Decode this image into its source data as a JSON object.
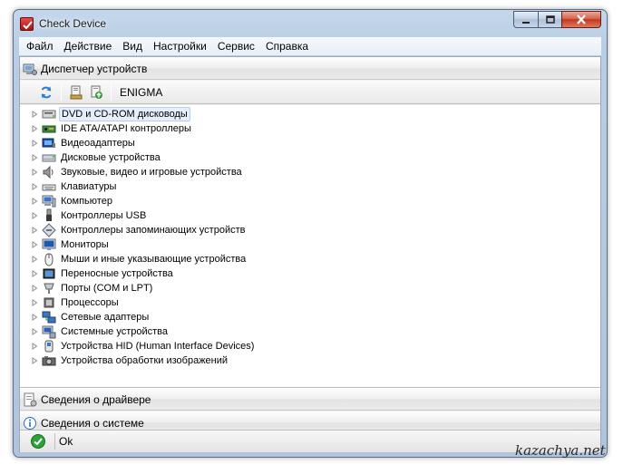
{
  "window": {
    "title": "Check Device"
  },
  "menu": {
    "items": [
      "Файл",
      "Действие",
      "Вид",
      "Настройки",
      "Сервис",
      "Справка"
    ]
  },
  "sections": {
    "device_manager": "Диспетчер устройств",
    "driver_info": "Сведения о драйвере",
    "system_info": "Сведения о системе"
  },
  "toolbar": {
    "computer_name": "ENIGMA"
  },
  "tree": {
    "items": [
      {
        "label": "DVD и CD-ROM дисководы",
        "icon": "dvd-drive-icon"
      },
      {
        "label": "IDE ATA/ATAPI контроллеры",
        "icon": "ide-controller-icon"
      },
      {
        "label": "Видеоадаптеры",
        "icon": "display-adapter-icon"
      },
      {
        "label": "Дисковые устройства",
        "icon": "disk-drive-icon"
      },
      {
        "label": "Звуковые, видео и игровые устройства",
        "icon": "speaker-icon"
      },
      {
        "label": "Клавиатуры",
        "icon": "keyboard-icon"
      },
      {
        "label": "Компьютер",
        "icon": "computer-icon"
      },
      {
        "label": "Контроллеры USB",
        "icon": "usb-icon"
      },
      {
        "label": "Контроллеры запоминающих устройств",
        "icon": "storage-controller-icon"
      },
      {
        "label": "Мониторы",
        "icon": "monitor-icon"
      },
      {
        "label": "Мыши и иные указывающие устройства",
        "icon": "mouse-icon"
      },
      {
        "label": "Переносные устройства",
        "icon": "portable-device-icon"
      },
      {
        "label": "Порты (COM и LPT)",
        "icon": "port-icon"
      },
      {
        "label": "Процессоры",
        "icon": "processor-icon"
      },
      {
        "label": "Сетевые адаптеры",
        "icon": "network-adapter-icon"
      },
      {
        "label": "Системные устройства",
        "icon": "system-device-icon"
      },
      {
        "label": "Устройства HID (Human Interface Devices)",
        "icon": "hid-icon"
      },
      {
        "label": "Устройства обработки изображений",
        "icon": "imaging-device-icon"
      }
    ],
    "selected_index": 0
  },
  "status": {
    "text": "Ok"
  },
  "watermark": {
    "text": "kazachya.net"
  },
  "colors": {
    "accent": "#3a7bd5",
    "status_ok": "#2ea23a",
    "close_red": "#c2381f"
  }
}
